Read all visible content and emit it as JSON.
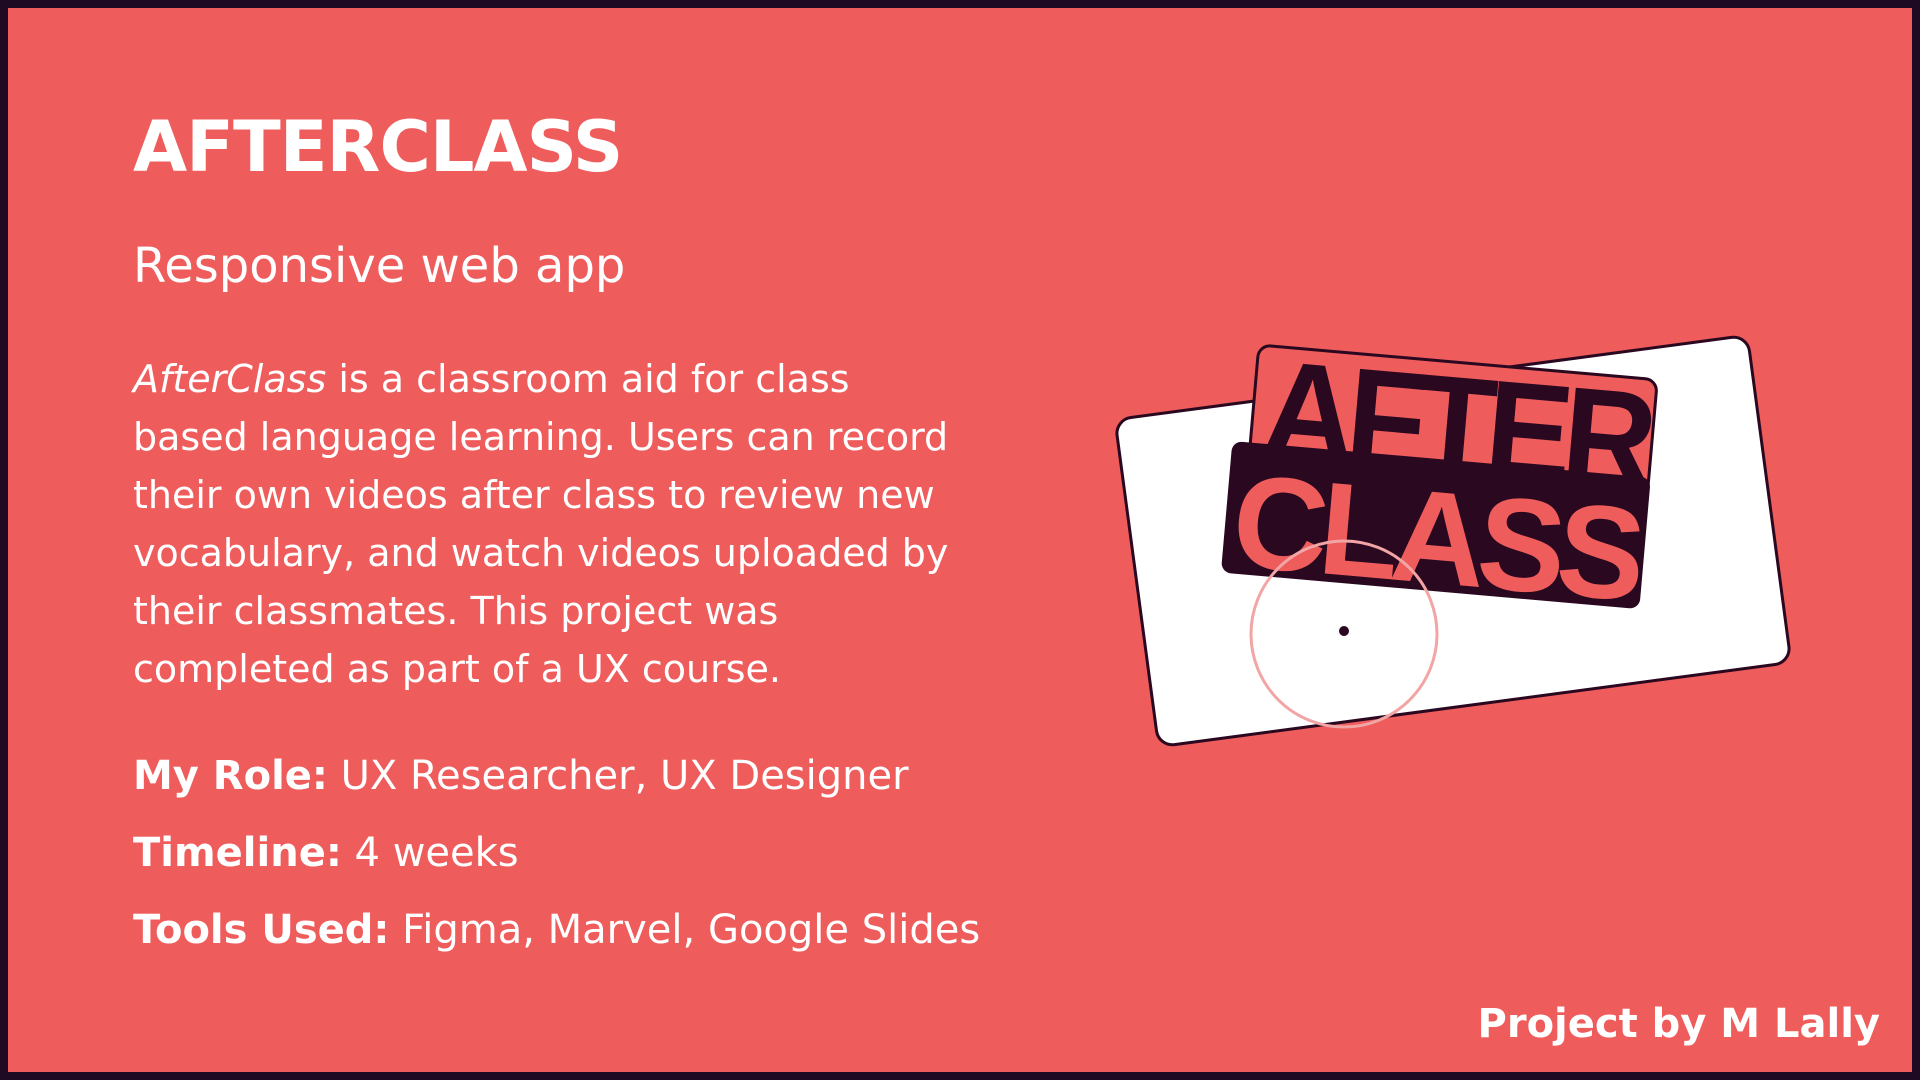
{
  "header": {
    "title": "AFTERCLASS",
    "subtitle": "Responsive web app"
  },
  "description": {
    "emphasis": "AfterClass",
    "text": " is a classroom aid for class based language learning. Users can record their own videos after class to review new vocabulary, and watch videos uploaded by their classmates. This project was completed as part of a UX course."
  },
  "details": {
    "role_label": "My Role:",
    "role_value": " UX Researcher, UX Designer",
    "timeline_label": "Timeline:",
    "timeline_value": " 4 weeks",
    "tools_label": "Tools Used:",
    "tools_value": " Figma, Marvel, Google Slides"
  },
  "footer": {
    "credit": "Project by M Lally"
  },
  "logo": {
    "line1": "AFTER",
    "line2": "CLASS"
  },
  "colors": {
    "background": "#ef5c5c",
    "frame": "#1e0a22",
    "text": "#ffffff",
    "logo_dark": "#2a0820"
  },
  "icons": [
    "afterclass-logo"
  ]
}
